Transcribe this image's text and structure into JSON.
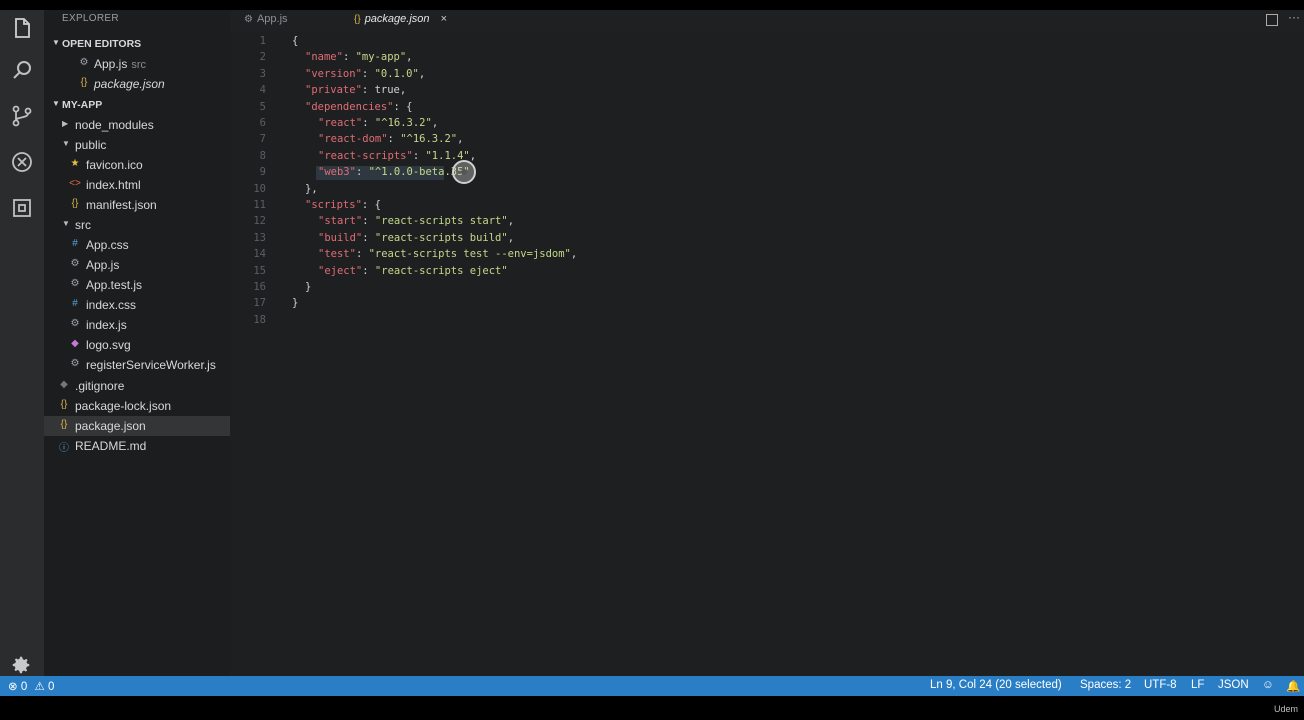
{
  "sidebar": {
    "header": "EXPLORER",
    "open_editors": {
      "title": "OPEN EDITORS",
      "items": [
        {
          "name": "App.js",
          "sub": "src"
        },
        {
          "name": "package.json",
          "sub": ""
        }
      ]
    },
    "project": {
      "title": "MY-APP",
      "items": [
        {
          "label": "node_modules"
        },
        {
          "label": "public"
        },
        {
          "label": "favicon.ico"
        },
        {
          "label": "index.html"
        },
        {
          "label": "manifest.json"
        },
        {
          "label": "src"
        },
        {
          "label": "App.css"
        },
        {
          "label": "App.js"
        },
        {
          "label": "App.test.js"
        },
        {
          "label": "index.css"
        },
        {
          "label": "index.js"
        },
        {
          "label": "logo.svg"
        },
        {
          "label": "registerServiceWorker.js"
        },
        {
          "label": ".gitignore"
        },
        {
          "label": "package-lock.json"
        },
        {
          "label": "package.json"
        },
        {
          "label": "README.md"
        }
      ]
    }
  },
  "tabs": [
    {
      "label": "App.js"
    },
    {
      "label": "package.json",
      "close": "×"
    }
  ],
  "editor": {
    "line_numbers": [
      "1",
      "2",
      "3",
      "4",
      "5",
      "6",
      "7",
      "8",
      "9",
      "10",
      "11",
      "12",
      "13",
      "14",
      "15",
      "16",
      "17",
      "18"
    ],
    "lines": [
      {
        "k": "",
        "v": "{"
      },
      {
        "k": "\"name\"",
        "sep": ": ",
        "v": "\"my-app\"",
        "end": ","
      },
      {
        "k": "\"version\"",
        "sep": ": ",
        "v": "\"0.1.0\"",
        "end": ","
      },
      {
        "k": "\"private\"",
        "sep": ": ",
        "v": "true",
        "end": ","
      },
      {
        "k": "\"dependencies\"",
        "sep": ": ",
        "v": "{",
        "end": ""
      },
      {
        "k": "\"react\"",
        "sep": ": ",
        "v": "\"^16.3.2\"",
        "end": ","
      },
      {
        "k": "\"react-dom\"",
        "sep": ": ",
        "v": "\"^16.3.2\"",
        "end": ","
      },
      {
        "k": "\"react-scripts\"",
        "sep": ": ",
        "v": "\"1.1.4\"",
        "end": ","
      },
      {
        "k": "\"web3\"",
        "sep": ": ",
        "v": "\"^1.0.0-beta.35\"",
        "end": ""
      },
      {
        "k": "",
        "v": "},"
      },
      {
        "k": "\"scripts\"",
        "sep": ": ",
        "v": "{",
        "end": ""
      },
      {
        "k": "\"start\"",
        "sep": ": ",
        "v": "\"react-scripts start\"",
        "end": ","
      },
      {
        "k": "\"build\"",
        "sep": ": ",
        "v": "\"react-scripts build\"",
        "end": ","
      },
      {
        "k": "\"test\"",
        "sep": ": ",
        "v": "\"react-scripts test --env=jsdom\"",
        "end": ","
      },
      {
        "k": "\"eject\"",
        "sep": ": ",
        "v": "\"react-scripts eject\"",
        "end": ""
      },
      {
        "k": "",
        "v": "}"
      },
      {
        "k": "",
        "v": "}"
      },
      {
        "k": "",
        "v": ""
      }
    ]
  },
  "status": {
    "errors": "0",
    "warnings": "0",
    "position": "Ln 9, Col 24 (20 selected)",
    "spaces": "Spaces: 2",
    "encoding": "UTF-8",
    "eol": "LF",
    "language": "JSON"
  },
  "watermark": "Udem"
}
